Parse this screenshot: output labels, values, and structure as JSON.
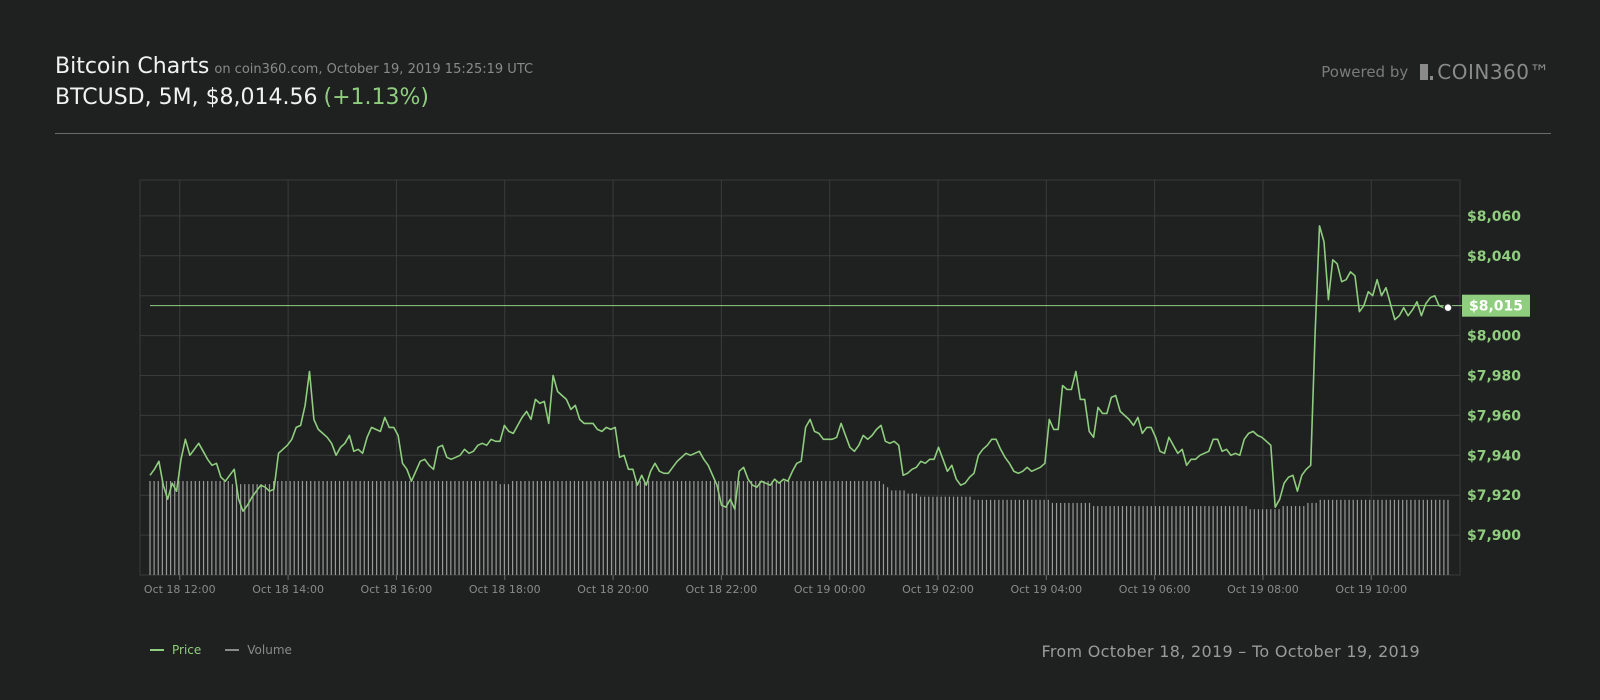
{
  "header": {
    "title": "Bitcoin Charts",
    "source": "on coin360.com, October 19, 2019 15:25:19 UTC",
    "ticker": "BTCUSD, 5M, $8,014.56",
    "change": "(+1.13%)",
    "powered_by": "Powered by",
    "brand": "COIN360™"
  },
  "colors": {
    "price": "#8fce7e",
    "volume": "#9a9a9a",
    "grid": "#3a3b3b",
    "background": "#1f2020"
  },
  "legend": {
    "price": "Price",
    "volume": "Volume"
  },
  "range_text": "From October 18, 2019 – To October 19, 2019",
  "chart_data": {
    "type": "line",
    "x_ticks": [
      "Oct 18 12:00",
      "Oct 18 14:00",
      "Oct 18 16:00",
      "Oct 18 18:00",
      "Oct 18 20:00",
      "Oct 18 22:00",
      "Oct 19 00:00",
      "Oct 19 02:00",
      "Oct 19 04:00",
      "Oct 19 06:00",
      "Oct 19 08:00",
      "Oct 19 10:00"
    ],
    "x_range": [
      "Oct 18 11:27",
      "Oct 19 11:25"
    ],
    "y_ticks": [
      7900,
      7920,
      7940,
      7960,
      7980,
      8000,
      8040,
      8060
    ],
    "y_tick_labels": [
      "$7,900",
      "$7,920",
      "$7,940",
      "$7,960",
      "$7,980",
      "$8,000",
      "$8,040",
      "$8,060"
    ],
    "ylim": [
      7880,
      8078
    ],
    "current_price_label": "$8,015",
    "current_price": 8015,
    "grid": true,
    "legend_position": "bottom-left",
    "series": [
      {
        "name": "Price",
        "values": [
          7930,
          7933,
          7937,
          7925,
          7918,
          7926,
          7922,
          7938,
          7948,
          7940,
          7943,
          7946,
          7942,
          7938,
          7935,
          7936,
          7929,
          7927,
          7930,
          7933,
          7918,
          7912,
          7915,
          7919,
          7922,
          7925,
          7924,
          7922,
          7923,
          7941,
          7943,
          7945,
          7948,
          7954,
          7955,
          7965,
          7982,
          7958,
          7953,
          7951,
          7949,
          7946,
          7940,
          7944,
          7946,
          7950,
          7942,
          7943,
          7941,
          7949,
          7954,
          7953,
          7952,
          7959,
          7954,
          7954,
          7950,
          7936,
          7933,
          7927,
          7932,
          7937,
          7938,
          7935,
          7933,
          7944,
          7945,
          7939,
          7938,
          7939,
          7940,
          7943,
          7941,
          7942,
          7945,
          7946,
          7945,
          7948,
          7947,
          7947,
          7955,
          7952,
          7951,
          7955,
          7959,
          7962,
          7958,
          7968,
          7966,
          7967,
          7956,
          7980,
          7972,
          7970,
          7968,
          7963,
          7965,
          7958,
          7956,
          7956,
          7956,
          7953,
          7952,
          7954,
          7953,
          7954,
          7939,
          7940,
          7933,
          7933,
          7925,
          7930,
          7925,
          7932,
          7936,
          7932,
          7931,
          7931,
          7934,
          7937,
          7939,
          7941,
          7940,
          7941,
          7942,
          7938,
          7935,
          7930,
          7925,
          7915,
          7914,
          7918,
          7913,
          7932,
          7934,
          7928,
          7925,
          7924,
          7927,
          7926,
          7925,
          7928,
          7926,
          7928,
          7927,
          7932,
          7936,
          7937,
          7954,
          7958,
          7952,
          7951,
          7948,
          7948,
          7948,
          7949,
          7956,
          7950,
          7944,
          7942,
          7945,
          7950,
          7948,
          7950,
          7953,
          7955,
          7947,
          7946,
          7947,
          7945,
          7930,
          7931,
          7933,
          7934,
          7937,
          7936,
          7938,
          7938,
          7944,
          7938,
          7932,
          7935,
          7928,
          7925,
          7926,
          7929,
          7931,
          7940,
          7943,
          7945,
          7948,
          7948,
          7943,
          7939,
          7936,
          7932,
          7931,
          7932,
          7934,
          7932,
          7933,
          7934,
          7936,
          7958,
          7953,
          7953,
          7975,
          7973,
          7973,
          7982,
          7968,
          7968,
          7952,
          7949,
          7964,
          7961,
          7961,
          7969,
          7970,
          7962,
          7960,
          7958,
          7955,
          7959,
          7951,
          7954,
          7954,
          7949,
          7942,
          7941,
          7949,
          7945,
          7941,
          7943,
          7935,
          7938,
          7938,
          7940,
          7941,
          7942,
          7948,
          7948,
          7942,
          7943,
          7940,
          7941,
          7940,
          7948,
          7951,
          7952,
          7950,
          7949,
          7947,
          7945,
          7914,
          7918,
          7926,
          7929,
          7930,
          7922,
          7930,
          7933,
          7935,
          8001,
          8055,
          8047,
          8018,
          8038,
          8036,
          8027,
          8028,
          8032,
          8030,
          8012,
          8015,
          8022,
          8020,
          8028,
          8020,
          8024,
          8016,
          8008,
          8010,
          8014,
          8010,
          8013,
          8017,
          8010,
          8016,
          8019,
          8020,
          8015,
          8014,
          8014
        ]
      },
      {
        "name": "Volume",
        "values": [
          0.3,
          0.3,
          0.3,
          0.3,
          0.3,
          0.3,
          0.3,
          0.3,
          0.3,
          0.3,
          0.3,
          0.3,
          0.3,
          0.3,
          0.3,
          0.3,
          0.3,
          0.3,
          0.3,
          0.3,
          0.29,
          0.29,
          0.29,
          0.29,
          0.29,
          0.29,
          0.29,
          0.29,
          0.29,
          0.29,
          0.3,
          0.3,
          0.3,
          0.3,
          0.3,
          0.3,
          0.3,
          0.3,
          0.3,
          0.3,
          0.3,
          0.3,
          0.3,
          0.3,
          0.3,
          0.3,
          0.3,
          0.3,
          0.3,
          0.3,
          0.3,
          0.3,
          0.3,
          0.3,
          0.3,
          0.3,
          0.3,
          0.3,
          0.3,
          0.3,
          0.3,
          0.3,
          0.3,
          0.3,
          0.3,
          0.3,
          0.3,
          0.3,
          0.3,
          0.3,
          0.3,
          0.3,
          0.3,
          0.3,
          0.3,
          0.3,
          0.3,
          0.3,
          0.3,
          0.3,
          0.3,
          0.3,
          0.3,
          0.3,
          0.3,
          0.29,
          0.29,
          0.29,
          0.3,
          0.3,
          0.3,
          0.3,
          0.3,
          0.3,
          0.3,
          0.3,
          0.3,
          0.3,
          0.3,
          0.3,
          0.3,
          0.3,
          0.3,
          0.3,
          0.3,
          0.3,
          0.3,
          0.3,
          0.3,
          0.3,
          0.3,
          0.3,
          0.3,
          0.3,
          0.3,
          0.3,
          0.3,
          0.3,
          0.3,
          0.3,
          0.3,
          0.3,
          0.3,
          0.3,
          0.3,
          0.3,
          0.3,
          0.3,
          0.3,
          0.3,
          0.3,
          0.3,
          0.3,
          0.3,
          0.3,
          0.3,
          0.3,
          0.3,
          0.3,
          0.3,
          0.3,
          0.3,
          0.3,
          0.3,
          0.3,
          0.3,
          0.3,
          0.3,
          0.3,
          0.3,
          0.3,
          0.3,
          0.3,
          0.3,
          0.3,
          0.3,
          0.3,
          0.3,
          0.3,
          0.3,
          0.3,
          0.3,
          0.3,
          0.3,
          0.3,
          0.3,
          0.3,
          0.3,
          0.3,
          0.3,
          0.3,
          0.3,
          0.3,
          0.3,
          0.3,
          0.3,
          0.3,
          0.3,
          0.29,
          0.28,
          0.27,
          0.27,
          0.27,
          0.27,
          0.26,
          0.26,
          0.26,
          0.25,
          0.25,
          0.25,
          0.25,
          0.25,
          0.25,
          0.25,
          0.25,
          0.25,
          0.25,
          0.25,
          0.25,
          0.25,
          0.24,
          0.24,
          0.24,
          0.24,
          0.24,
          0.24,
          0.24,
          0.24,
          0.24,
          0.24,
          0.24,
          0.24,
          0.24,
          0.24,
          0.24,
          0.24,
          0.24,
          0.24,
          0.24,
          0.23,
          0.23,
          0.23,
          0.23,
          0.23,
          0.23,
          0.23,
          0.23,
          0.23,
          0.23,
          0.22,
          0.22,
          0.22,
          0.22,
          0.22,
          0.22,
          0.22,
          0.22,
          0.22,
          0.22,
          0.22,
          0.22,
          0.22,
          0.22,
          0.22,
          0.22,
          0.22,
          0.22,
          0.22,
          0.22,
          0.22,
          0.22,
          0.22,
          0.22,
          0.22,
          0.22,
          0.22,
          0.22,
          0.22,
          0.22,
          0.22,
          0.22,
          0.22,
          0.22,
          0.22,
          0.22,
          0.22,
          0.22,
          0.21,
          0.21,
          0.21,
          0.21,
          0.21,
          0.21,
          0.21,
          0.21,
          0.22,
          0.22,
          0.22,
          0.22,
          0.22,
          0.22,
          0.23,
          0.23,
          0.23,
          0.24,
          0.24,
          0.24,
          0.24,
          0.24,
          0.24,
          0.24,
          0.24,
          0.24,
          0.24,
          0.24,
          0.24,
          0.24,
          0.24,
          0.24,
          0.24,
          0.24,
          0.24,
          0.24,
          0.24,
          0.24,
          0.24,
          0.24,
          0.24,
          0.24,
          0.24,
          0.24,
          0.24,
          0.24,
          0.24,
          0.24,
          0.24
        ]
      }
    ]
  }
}
